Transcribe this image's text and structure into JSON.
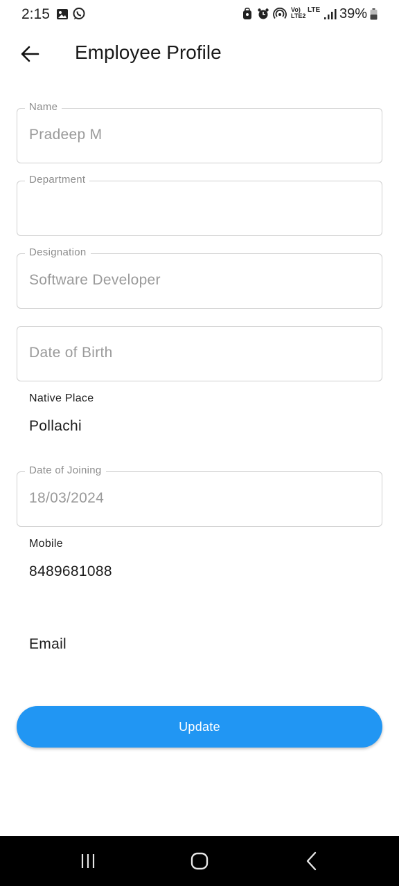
{
  "status_bar": {
    "time": "2:15",
    "network_top": "Vo)",
    "network_bottom": "LTE2",
    "lte": "LTE",
    "battery": "39%"
  },
  "app_bar": {
    "title": "Employee Profile",
    "back_icon": "arrow-left-icon"
  },
  "form": {
    "name": {
      "label": "Name",
      "value": "Pradeep M"
    },
    "department": {
      "label": "Department",
      "value": ""
    },
    "designation": {
      "label": "Designation",
      "value": "Software Developer"
    },
    "date_of_birth": {
      "placeholder": "Date of Birth"
    },
    "native_place": {
      "label": "Native Place",
      "value": "Pollachi"
    },
    "date_of_joining": {
      "label": "Date of Joining",
      "value": "18/03/2024"
    },
    "mobile": {
      "label": "Mobile",
      "value": "8489681088"
    },
    "email": {
      "label": "Email"
    }
  },
  "update_button": {
    "label": "Update",
    "color": "#2196f3"
  },
  "nav_bar": {
    "icons": [
      "recent-apps-icon",
      "home-icon",
      "back-icon"
    ]
  }
}
